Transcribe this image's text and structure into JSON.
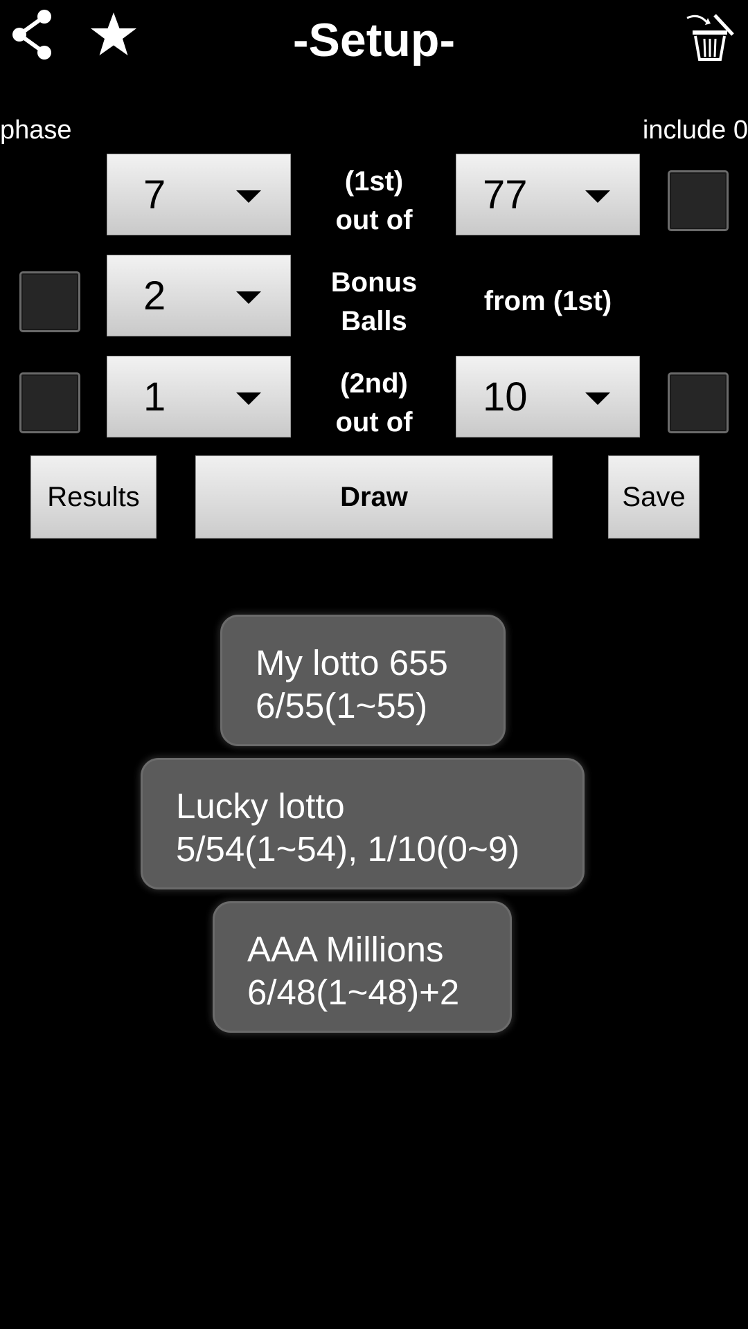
{
  "header": {
    "title": "-Setup-",
    "share_icon": "share-icon",
    "favorite_icon": "star-icon",
    "delete_icon": "trash-icon"
  },
  "labels": {
    "phase": "phase",
    "include_zero": "include 0"
  },
  "rows": [
    {
      "select_value": "7",
      "label_line1": "(1st)",
      "label_line2": "out of",
      "right_select_value": "77",
      "left_checked": false,
      "right_checked": false
    },
    {
      "select_value": "2",
      "label_line1": "Bonus",
      "label_line2": "Balls",
      "right_text": "from (1st)",
      "left_checked": false
    },
    {
      "select_value": "1",
      "label_line1": "(2nd)",
      "label_line2": "out of",
      "right_select_value": "10",
      "left_checked": false,
      "right_checked": false
    }
  ],
  "buttons": {
    "results": "Results",
    "draw": "Draw",
    "save": "Save"
  },
  "saved_items": [
    {
      "name": "My lotto 655",
      "config": "6/55(1~55)"
    },
    {
      "name": "Lucky lotto",
      "config": "5/54(1~54), 1/10(0~9)"
    },
    {
      "name": "AAA Millions",
      "config": "6/48(1~48)+2"
    }
  ],
  "colors": {
    "background": "#000000",
    "card": "#5b5b5b",
    "control": "#dcdcdc"
  }
}
